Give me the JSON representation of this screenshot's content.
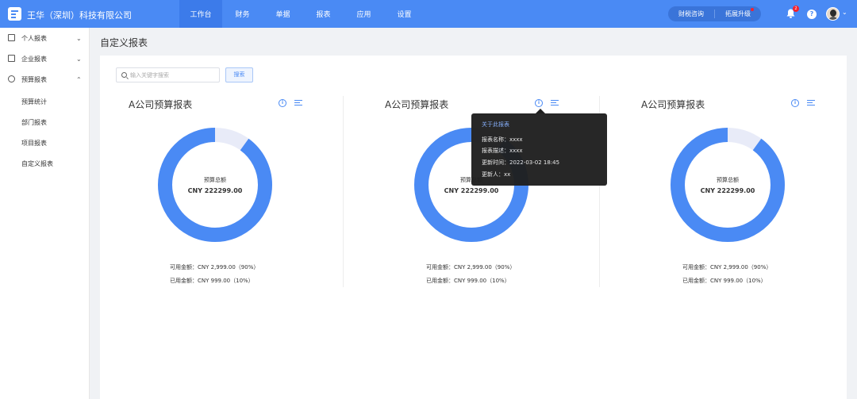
{
  "header": {
    "company": "王华（深圳）科技有限公司",
    "nav": [
      "工作台",
      "财务",
      "单据",
      "报表",
      "应用",
      "设置"
    ],
    "active_nav": 0,
    "pill": {
      "left": "财税咨询",
      "right": "拓展升级"
    },
    "notification_count": "2",
    "help": "?"
  },
  "sidebar": {
    "groups": [
      {
        "label": "个人报表",
        "icon": "checkbox-icon",
        "expanded": false
      },
      {
        "label": "企业报表",
        "icon": "building-icon",
        "expanded": false
      },
      {
        "label": "预算报表",
        "icon": "pie-chart-icon",
        "expanded": true
      }
    ],
    "sub_items": [
      "预算统计",
      "部门报表",
      "项目报表",
      "自定义报表"
    ]
  },
  "page": {
    "title": "自定义报表",
    "search_placeholder": "输入关键字搜索",
    "search_button": "搜索"
  },
  "cards": [
    {
      "title": "A公司预算报表",
      "center_label": "预算总额",
      "center_value": "CNY 222299.00",
      "available": "可用金额：CNY 2,999.00（90%）",
      "used": "已用金额：CNY 999.00（10%）",
      "available_fraction": 0.9,
      "used_fraction": 0.1
    },
    {
      "title": "A公司预算报表",
      "center_label": "预算总额",
      "center_value": "CNY 222299.00",
      "available": "可用金额：CNY 2,999.00（90%）",
      "used": "已用金额：CNY 999.00（10%）",
      "available_fraction": 0.9,
      "used_fraction": 0.1
    },
    {
      "title": "A公司预算报表",
      "center_label": "预算总额",
      "center_value": "CNY 222299.00",
      "available": "可用金额：CNY 2,999.00（90%）",
      "used": "已用金额：CNY 999.00（10%）",
      "available_fraction": 0.9,
      "used_fraction": 0.1
    }
  ],
  "tooltip": {
    "title": "关于此报表",
    "rows": [
      "报表名称：xxxx",
      "报表描述：xxxx",
      "更新时间：2022-03-02 18:45",
      "更新人：xx"
    ]
  },
  "colors": {
    "primary": "#4a8af4",
    "ring_track": "#e8ebf8",
    "tooltip_bg": "#1f1f1f"
  }
}
